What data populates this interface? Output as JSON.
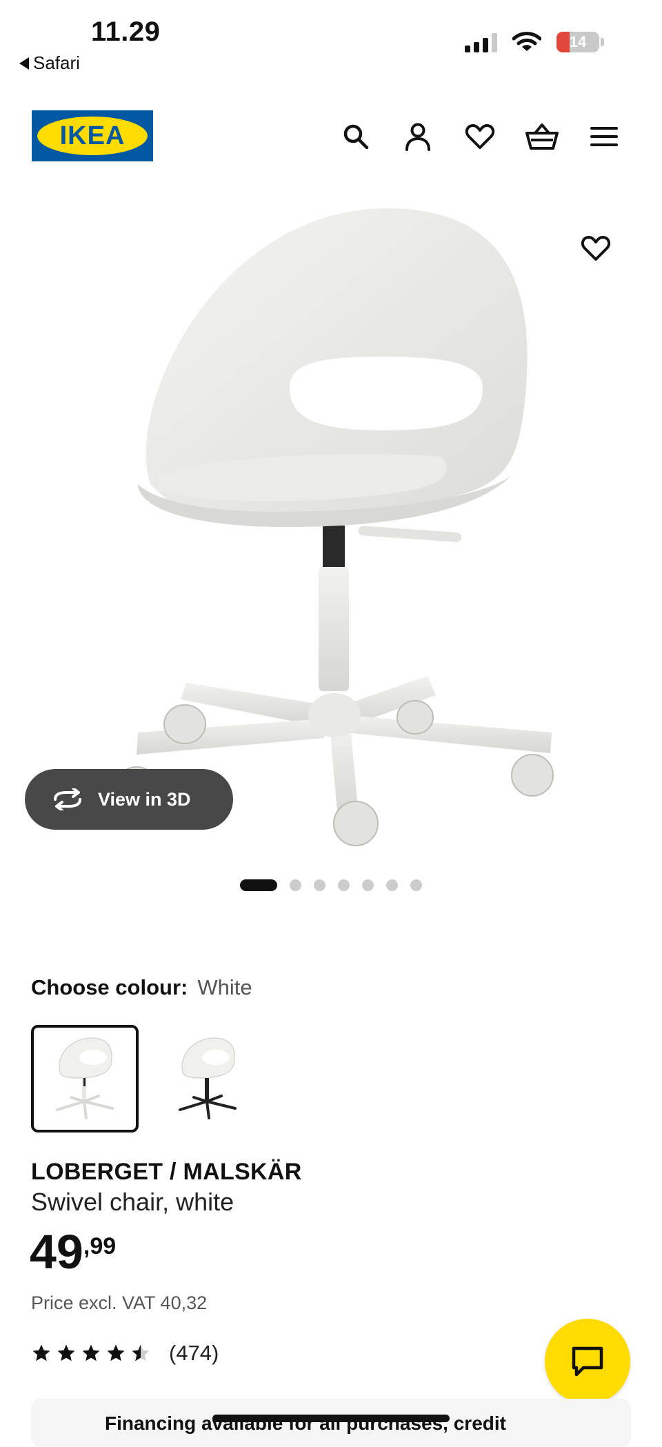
{
  "status_bar": {
    "time": "11.29",
    "back_app": "Safari",
    "battery_level": "14",
    "battery_color": "#e2463b"
  },
  "header": {
    "logo_text": "IKEA",
    "brand_colors": {
      "blue": "#0058a3",
      "yellow": "#ffdb00"
    },
    "icons": [
      "search-icon",
      "user-icon",
      "heart-icon",
      "basket-icon",
      "menu-icon"
    ]
  },
  "gallery": {
    "view_3d_label": "View in 3D",
    "slide_count": 7,
    "active_slide": 1
  },
  "colour": {
    "label": "Choose colour:",
    "selected": "White",
    "options": [
      "White",
      "Black"
    ]
  },
  "product": {
    "name": "LOBERGET / MALSKÄR",
    "description": "Swivel chair, white",
    "price_int": "49",
    "price_dec": ",99",
    "vat_text": "Price excl. VAT 40,32",
    "rating_stars": 4.5,
    "review_count": "(474)"
  },
  "financing": {
    "text": "Financing available for all purchases, credit"
  }
}
